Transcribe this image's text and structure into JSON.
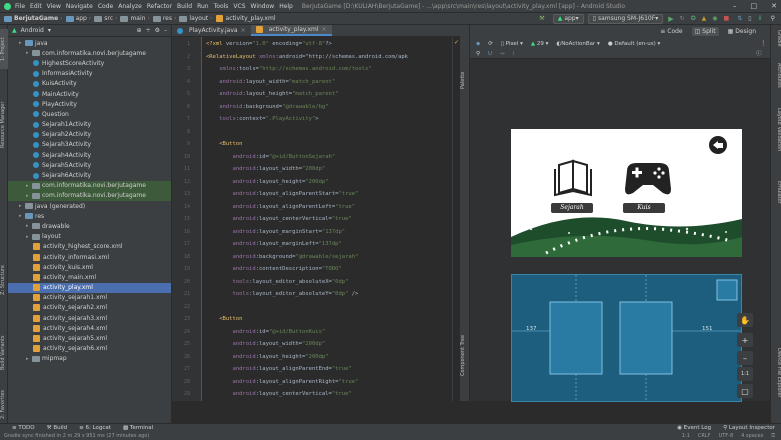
{
  "menubar": {
    "items": [
      "File",
      "Edit",
      "View",
      "Navigate",
      "Code",
      "Analyze",
      "Refactor",
      "Build",
      "Run",
      "Tools",
      "VCS",
      "Window",
      "Help"
    ],
    "title": "BerjutaGame [D:\\KULIAH\\BerjutaGame] - ...\\app\\src\\main\\res\\layout\\activity_play.xml [app] - Android Studio"
  },
  "navbar": {
    "crumbs": [
      "BerjutaGame",
      "app",
      "src",
      "main",
      "res",
      "layout",
      "activity_play.xml"
    ],
    "run_config": "app",
    "device": "samsung SM-J610F"
  },
  "left_strip": {
    "project": "1: Project",
    "resource_manager": "Resource Manager",
    "structure": "Z: Structure",
    "build_variants": "Build Variants",
    "favorites": "2: Favorites"
  },
  "project_panel": {
    "view": "Android",
    "tree": [
      {
        "label": "java",
        "type": "folder",
        "indent": 1
      },
      {
        "label": "com.informatika.novi.berjutagame",
        "type": "folder",
        "indent": 2
      },
      {
        "label": "HighestScoreActivity",
        "type": "class",
        "indent": 3
      },
      {
        "label": "InformasiActivity",
        "type": "class",
        "indent": 3
      },
      {
        "label": "KuisActivity",
        "type": "class",
        "indent": 3
      },
      {
        "label": "MainActivity",
        "type": "class",
        "indent": 3
      },
      {
        "label": "PlayActivity",
        "type": "class",
        "indent": 3
      },
      {
        "label": "Question",
        "type": "class",
        "indent": 3
      },
      {
        "label": "Sejarah1Activity",
        "type": "class",
        "indent": 3
      },
      {
        "label": "Sejarah2Activity",
        "type": "class",
        "indent": 3
      },
      {
        "label": "Sejarah3Activity",
        "type": "class",
        "indent": 3
      },
      {
        "label": "Sejarah4Activity",
        "type": "class",
        "indent": 3
      },
      {
        "label": "Sejarah5Activity",
        "type": "class",
        "indent": 3
      },
      {
        "label": "Sejarah6Activity",
        "type": "class",
        "indent": 3
      },
      {
        "label": "com.informatika.novi.berjutagame",
        "type": "folder",
        "indent": 2,
        "hl": true
      },
      {
        "label": "com.informatika.novi.berjutagame",
        "type": "folder",
        "indent": 2,
        "hl": true
      },
      {
        "label": "java (generated)",
        "type": "folder",
        "indent": 1
      },
      {
        "label": "res",
        "type": "folder",
        "indent": 1
      },
      {
        "label": "drawable",
        "type": "folder",
        "indent": 2
      },
      {
        "label": "layout",
        "type": "folder",
        "indent": 2
      },
      {
        "label": "activity_highest_score.xml",
        "type": "xml",
        "indent": 3
      },
      {
        "label": "activity_informasi.xml",
        "type": "xml",
        "indent": 3
      },
      {
        "label": "activity_kuis.xml",
        "type": "xml",
        "indent": 3
      },
      {
        "label": "activity_main.xml",
        "type": "xml",
        "indent": 3
      },
      {
        "label": "activity_play.xml",
        "type": "xml",
        "indent": 3,
        "sel": true
      },
      {
        "label": "activity_sejarah1.xml",
        "type": "xml",
        "indent": 3
      },
      {
        "label": "activity_sejarah2.xml",
        "type": "xml",
        "indent": 3
      },
      {
        "label": "activity_sejarah3.xml",
        "type": "xml",
        "indent": 3
      },
      {
        "label": "activity_sejarah4.xml",
        "type": "xml",
        "indent": 3
      },
      {
        "label": "activity_sejarah5.xml",
        "type": "xml",
        "indent": 3
      },
      {
        "label": "activity_sejarah6.xml",
        "type": "xml",
        "indent": 3
      },
      {
        "label": "mipmap",
        "type": "folder",
        "indent": 2
      }
    ]
  },
  "editor_tabs": [
    {
      "label": "PlayActivity.java",
      "active": false
    },
    {
      "label": "activity_play.xml",
      "active": true
    }
  ],
  "code_lines": [
    "<?xml version=\"1.0\" encoding=\"utf-8\"?>",
    "<RelativeLayout xmlns:android=\"http://schemas.android.com/apk",
    "    xmlns:tools=\"http://schemas.android.com/tools\"",
    "    android:layout_width=\"match_parent\"",
    "    android:layout_height=\"match_parent\"",
    "    android:background=\"@drawable/bg\"",
    "    tools:context=\".PlayActivity\">",
    "",
    "    <Button",
    "        android:id=\"@+id/ButtonSejarah\"",
    "        android:layout_width=\"200dp\"",
    "        android:layout_height=\"200dp\"",
    "        android:layout_alignParentStart=\"true\"",
    "        android:layout_alignParentLeft=\"true\"",
    "        android:layout_centerVertical=\"true\"",
    "        android:layout_marginStart=\"137dp\"",
    "        android:layout_marginLeft=\"137dp\"",
    "        android:background=\"@drawable/sejarah\"",
    "        android:contentDescription=\"TODO\"",
    "        tools:layout_editor_absoluteX=\"0dp\"",
    "        tools:layout_editor_absoluteY=\"0dp\" />",
    "",
    "    <Button",
    "        android:id=\"@+id/ButtonKuis\"",
    "        android:layout_width=\"200dp\"",
    "        android:layout_height=\"200dp\"",
    "        android:layout_alignParentEnd=\"true\"",
    "        android:layout_alignParentRight=\"true\"",
    "        android:layout_centerVertical=\"true\""
  ],
  "design": {
    "view_modes": [
      "Code",
      "Split",
      "Design"
    ],
    "active_mode": "Split",
    "device": "Pixel",
    "api": "29",
    "theme": "NoActionBar",
    "locale": "Default (en-us)",
    "palette_label": "Palette",
    "component_tree_label": "Component Tree",
    "attributes_label": "Attributes",
    "layout_validation_label": "Layout Validation",
    "emulator_label": "Emulator",
    "file_explorer_label": "Device File Explorer",
    "margin_left": "137",
    "margin_right": "151",
    "zoom_ratio": "1:1",
    "btn_sejarah": "Sejarah",
    "btn_kuis": "Kuis"
  },
  "bottom_tabs": [
    "TODO",
    "Build",
    "6: Logcat",
    "Terminal"
  ],
  "bottom_right": [
    "Event Log",
    "Layout Inspector"
  ],
  "status": {
    "message": "Gradle sync finished in 2 m 29 s 951 ms (27 minutes ago)",
    "right": [
      "1:1",
      "CRLF",
      "UTF-8",
      "4 spaces"
    ]
  },
  "colors": {
    "bg": "#2b2b2b",
    "panel": "#3c3f41",
    "selection": "#4b6eaf",
    "blueprint": "#1d5d7e",
    "accent": "#4a88c7"
  }
}
